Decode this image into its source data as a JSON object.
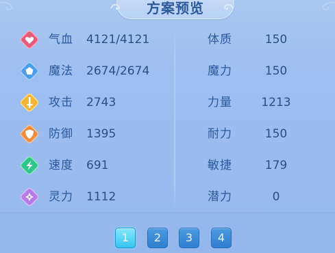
{
  "title": "方案预览",
  "left_attrs": [
    {
      "icon": "heart-icon",
      "label": "气血",
      "value": "4121/4121",
      "color": "#e85a7a"
    },
    {
      "icon": "mana-icon",
      "label": "魔法",
      "value": "2674/2674",
      "color": "#4a9ef0"
    },
    {
      "icon": "sword-icon",
      "label": "攻击",
      "value": "2743",
      "color": "#f2b632"
    },
    {
      "icon": "shield-icon",
      "label": "防御",
      "value": "1395",
      "color": "#f08c3c"
    },
    {
      "icon": "lightning-icon",
      "label": "速度",
      "value": "691",
      "color": "#2fc58a"
    },
    {
      "icon": "spirit-icon",
      "label": "灵力",
      "value": "1112",
      "color": "#b77ae8"
    }
  ],
  "right_attrs": [
    {
      "label": "体质",
      "value": "150"
    },
    {
      "label": "魔力",
      "value": "150"
    },
    {
      "label": "力量",
      "value": "1213"
    },
    {
      "label": "耐力",
      "value": "150"
    },
    {
      "label": "敏捷",
      "value": "179"
    },
    {
      "label": "潜力",
      "value": "0"
    }
  ],
  "pages": [
    "1",
    "2",
    "3",
    "4"
  ],
  "active_page": "1"
}
